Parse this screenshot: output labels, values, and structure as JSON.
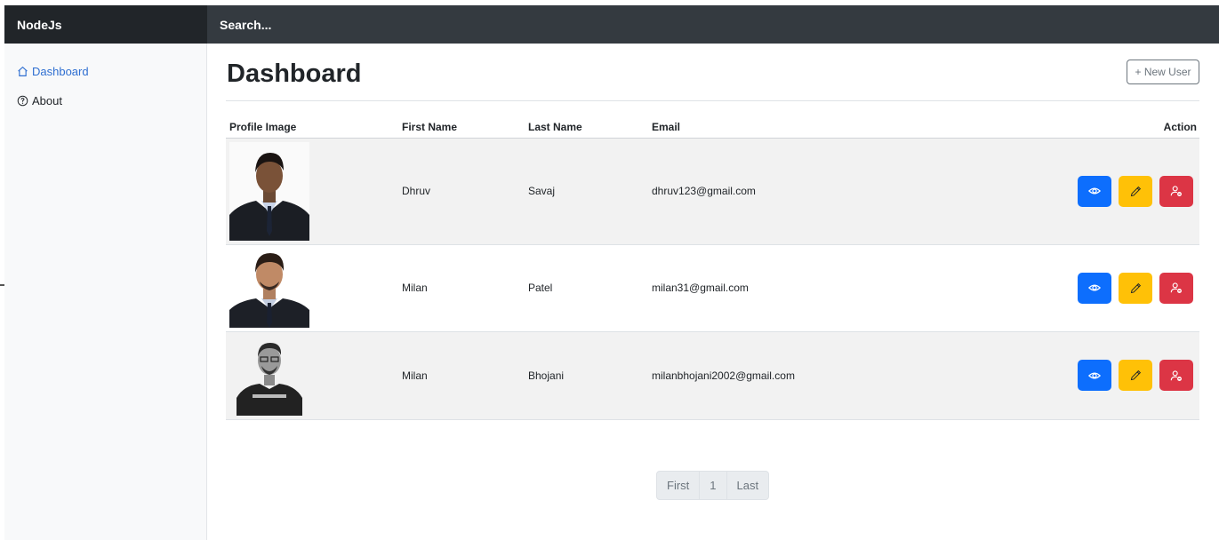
{
  "app": {
    "brand": "NodeJs",
    "search_placeholder": "Search..."
  },
  "sidebar": {
    "items": [
      {
        "label": "Dashboard",
        "icon": "home-icon",
        "active": true
      },
      {
        "label": "About",
        "icon": "question-circle-icon",
        "active": false
      }
    ]
  },
  "page": {
    "title": "Dashboard",
    "new_user_label": "+ New User"
  },
  "table": {
    "headers": [
      "Profile Image",
      "First Name",
      "Last Name",
      "Email",
      "Action"
    ],
    "rows": [
      {
        "first_name": "Dhruv",
        "last_name": "Savaj",
        "email": "dhruv123@gmail.com"
      },
      {
        "first_name": "Milan",
        "last_name": "Patel",
        "email": "milan31@gmail.com"
      },
      {
        "first_name": "Milan",
        "last_name": "Bhojani",
        "email": "milanbhojani2002@gmail.com"
      }
    ],
    "action_icons": [
      "eye-icon",
      "pencil-icon",
      "user-remove-icon"
    ]
  },
  "pagination": {
    "first": "First",
    "page": "1",
    "last": "Last"
  },
  "colors": {
    "primary": "#0d6efd",
    "warning": "#ffc107",
    "danger": "#dc3545",
    "nav_dark": "#212529",
    "nav": "#343a40"
  }
}
